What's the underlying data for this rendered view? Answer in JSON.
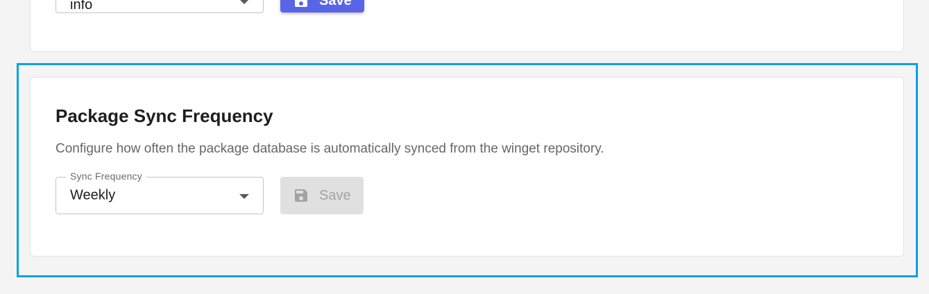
{
  "log_level_section": {
    "select_value": "info",
    "save_label": "Save"
  },
  "sync_section": {
    "title": "Package Sync Frequency",
    "description": "Configure how often the package database is automatically synced from the winget repository.",
    "select_legend": "Sync Frequency",
    "select_value": "Weekly",
    "save_label": "Save",
    "save_disabled": true
  },
  "colors": {
    "primary": "#5865e6",
    "highlight_border": "#00a3e0",
    "disabled_bg": "#e0e0e0",
    "disabled_text": "#a3a3a3"
  }
}
